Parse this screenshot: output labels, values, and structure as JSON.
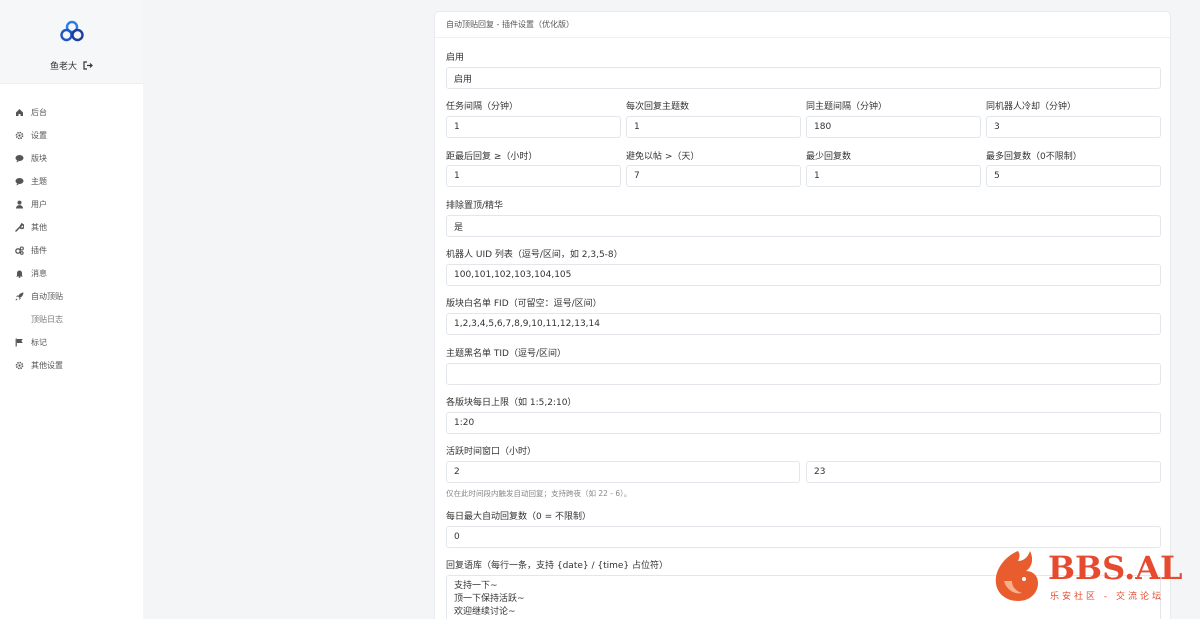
{
  "sidebar": {
    "user_name": "鱼老大",
    "items": [
      {
        "label": "后台",
        "icon": "home-icon"
      },
      {
        "label": "设置",
        "icon": "gear-icon"
      },
      {
        "label": "版块",
        "icon": "chat-icon"
      },
      {
        "label": "主题",
        "icon": "chat-icon"
      },
      {
        "label": "用户",
        "icon": "user-icon"
      },
      {
        "label": "其他",
        "icon": "wrench-icon"
      },
      {
        "label": "插件",
        "icon": "plugin-icon"
      },
      {
        "label": "消息",
        "icon": "bell-icon"
      },
      {
        "label": "自动顶贴",
        "icon": "rocket-icon"
      },
      {
        "label": "顶贴日志",
        "icon": ""
      },
      {
        "label": "标记",
        "icon": "flag-icon"
      },
      {
        "label": "其他设置",
        "icon": "gear-icon"
      }
    ]
  },
  "card": {
    "title": "自动顶贴回复 - 插件设置（优化版）",
    "enable": {
      "label": "启用",
      "value": "启用"
    },
    "row1": [
      {
        "label": "任务间隔（分钟）",
        "value": "1"
      },
      {
        "label": "每次回复主题数",
        "value": "1"
      },
      {
        "label": "同主题间隔（分钟）",
        "value": "180"
      },
      {
        "label": "同机器人冷却（分钟）",
        "value": "3"
      }
    ],
    "row2": [
      {
        "label": "距最后回复 ≥（小时）",
        "value": "1"
      },
      {
        "label": "避免以帖 >（天）",
        "value": "7"
      },
      {
        "label": "最少回复数",
        "value": "1"
      },
      {
        "label": "最多回复数（0不限制）",
        "value": "5"
      }
    ],
    "exclude_top": {
      "label": "排除置顶/精华",
      "value": "是"
    },
    "robot_uids": {
      "label": "机器人 UID 列表（逗号/区间，如 2,3,5-8）",
      "value": "100,101,102,103,104,105"
    },
    "forum_whitelist": {
      "label": "版块白名单 FID（可留空：逗号/区间）",
      "value": "1,2,3,4,5,6,7,8,9,10,11,12,13,14"
    },
    "thread_blacklist": {
      "label": "主题黑名单 TID（逗号/区间）",
      "value": ""
    },
    "daily_limit": {
      "label": "各版块每日上限（如 1:5,2:10）",
      "value": "1:20"
    },
    "active_window": {
      "label": "活跃时间窗口（小时）",
      "start": "2",
      "end": "23",
      "hint": "仅在此时间段内触发自动回复；支持跨夜（如 22 - 6）。"
    },
    "daily_max": {
      "label": "每日最大自动回复数（0 = 不限制）",
      "value": "0"
    },
    "corpus": {
      "label": "回复语库（每行一条，支持 {date} / {time} 占位符）",
      "lines": [
        "支持一下~",
        "顶一下保持活跃~",
        "欢迎继续讨论~"
      ]
    }
  },
  "watermark": {
    "title": "BBS.AL",
    "subtitle": "乐安社区 - 交流论坛"
  }
}
